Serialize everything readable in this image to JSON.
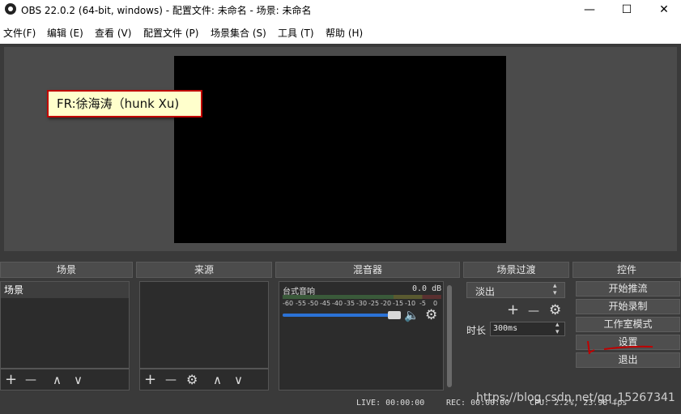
{
  "window": {
    "title": "OBS 22.0.2 (64-bit, windows) - 配置文件: 未命名 - 场景: 未命名",
    "minimize_glyph": "—",
    "maximize_glyph": "☐",
    "close_glyph": "✕"
  },
  "menu": {
    "items": [
      "文件(F)",
      "编辑 (E)",
      "查看 (V)",
      "配置文件 (P)",
      "场景集合 (S)",
      "工具 (T)",
      "帮助 (H)"
    ]
  },
  "preview": {
    "text_source": "FR:徐海涛（hunk Xu)"
  },
  "docks": {
    "scenes": {
      "header": "场景",
      "items": [
        "场景"
      ]
    },
    "sources": {
      "header": "来源"
    },
    "mixer": {
      "header": "混音器",
      "track_name": "台式音响",
      "db_value": "0.0 dB",
      "scale": [
        "-60",
        "-55",
        "-50",
        "-45",
        "-40",
        "-35",
        "-30",
        "-25",
        "-20",
        "-15",
        "-10",
        "-5",
        "0"
      ],
      "volume_fraction": 1.0
    },
    "transitions": {
      "header": "场景过渡",
      "selected": "淡出",
      "duration_label": "时长",
      "duration_value": "300ms"
    },
    "controls": {
      "header": "控件",
      "buttons": [
        "开始推流",
        "开始录制",
        "工作室模式",
        "设置",
        "退出"
      ]
    }
  },
  "status": {
    "live": "LIVE: 00:00:00",
    "rec": "REC: 00:00:00",
    "cpu": "CPU: 2.2%, 23.98 fps"
  },
  "watermark": "https://blog.csdn.net/qq_15267341",
  "icons": {
    "plus": "+",
    "minus": "—",
    "up": "∧",
    "down": "∨",
    "gear": "⚙",
    "speaker": "🔈",
    "spin_up": "▴",
    "spin_down": "▾"
  },
  "colors": {
    "accent_blue": "#2b72d6",
    "annotation_red": "#c00000"
  }
}
